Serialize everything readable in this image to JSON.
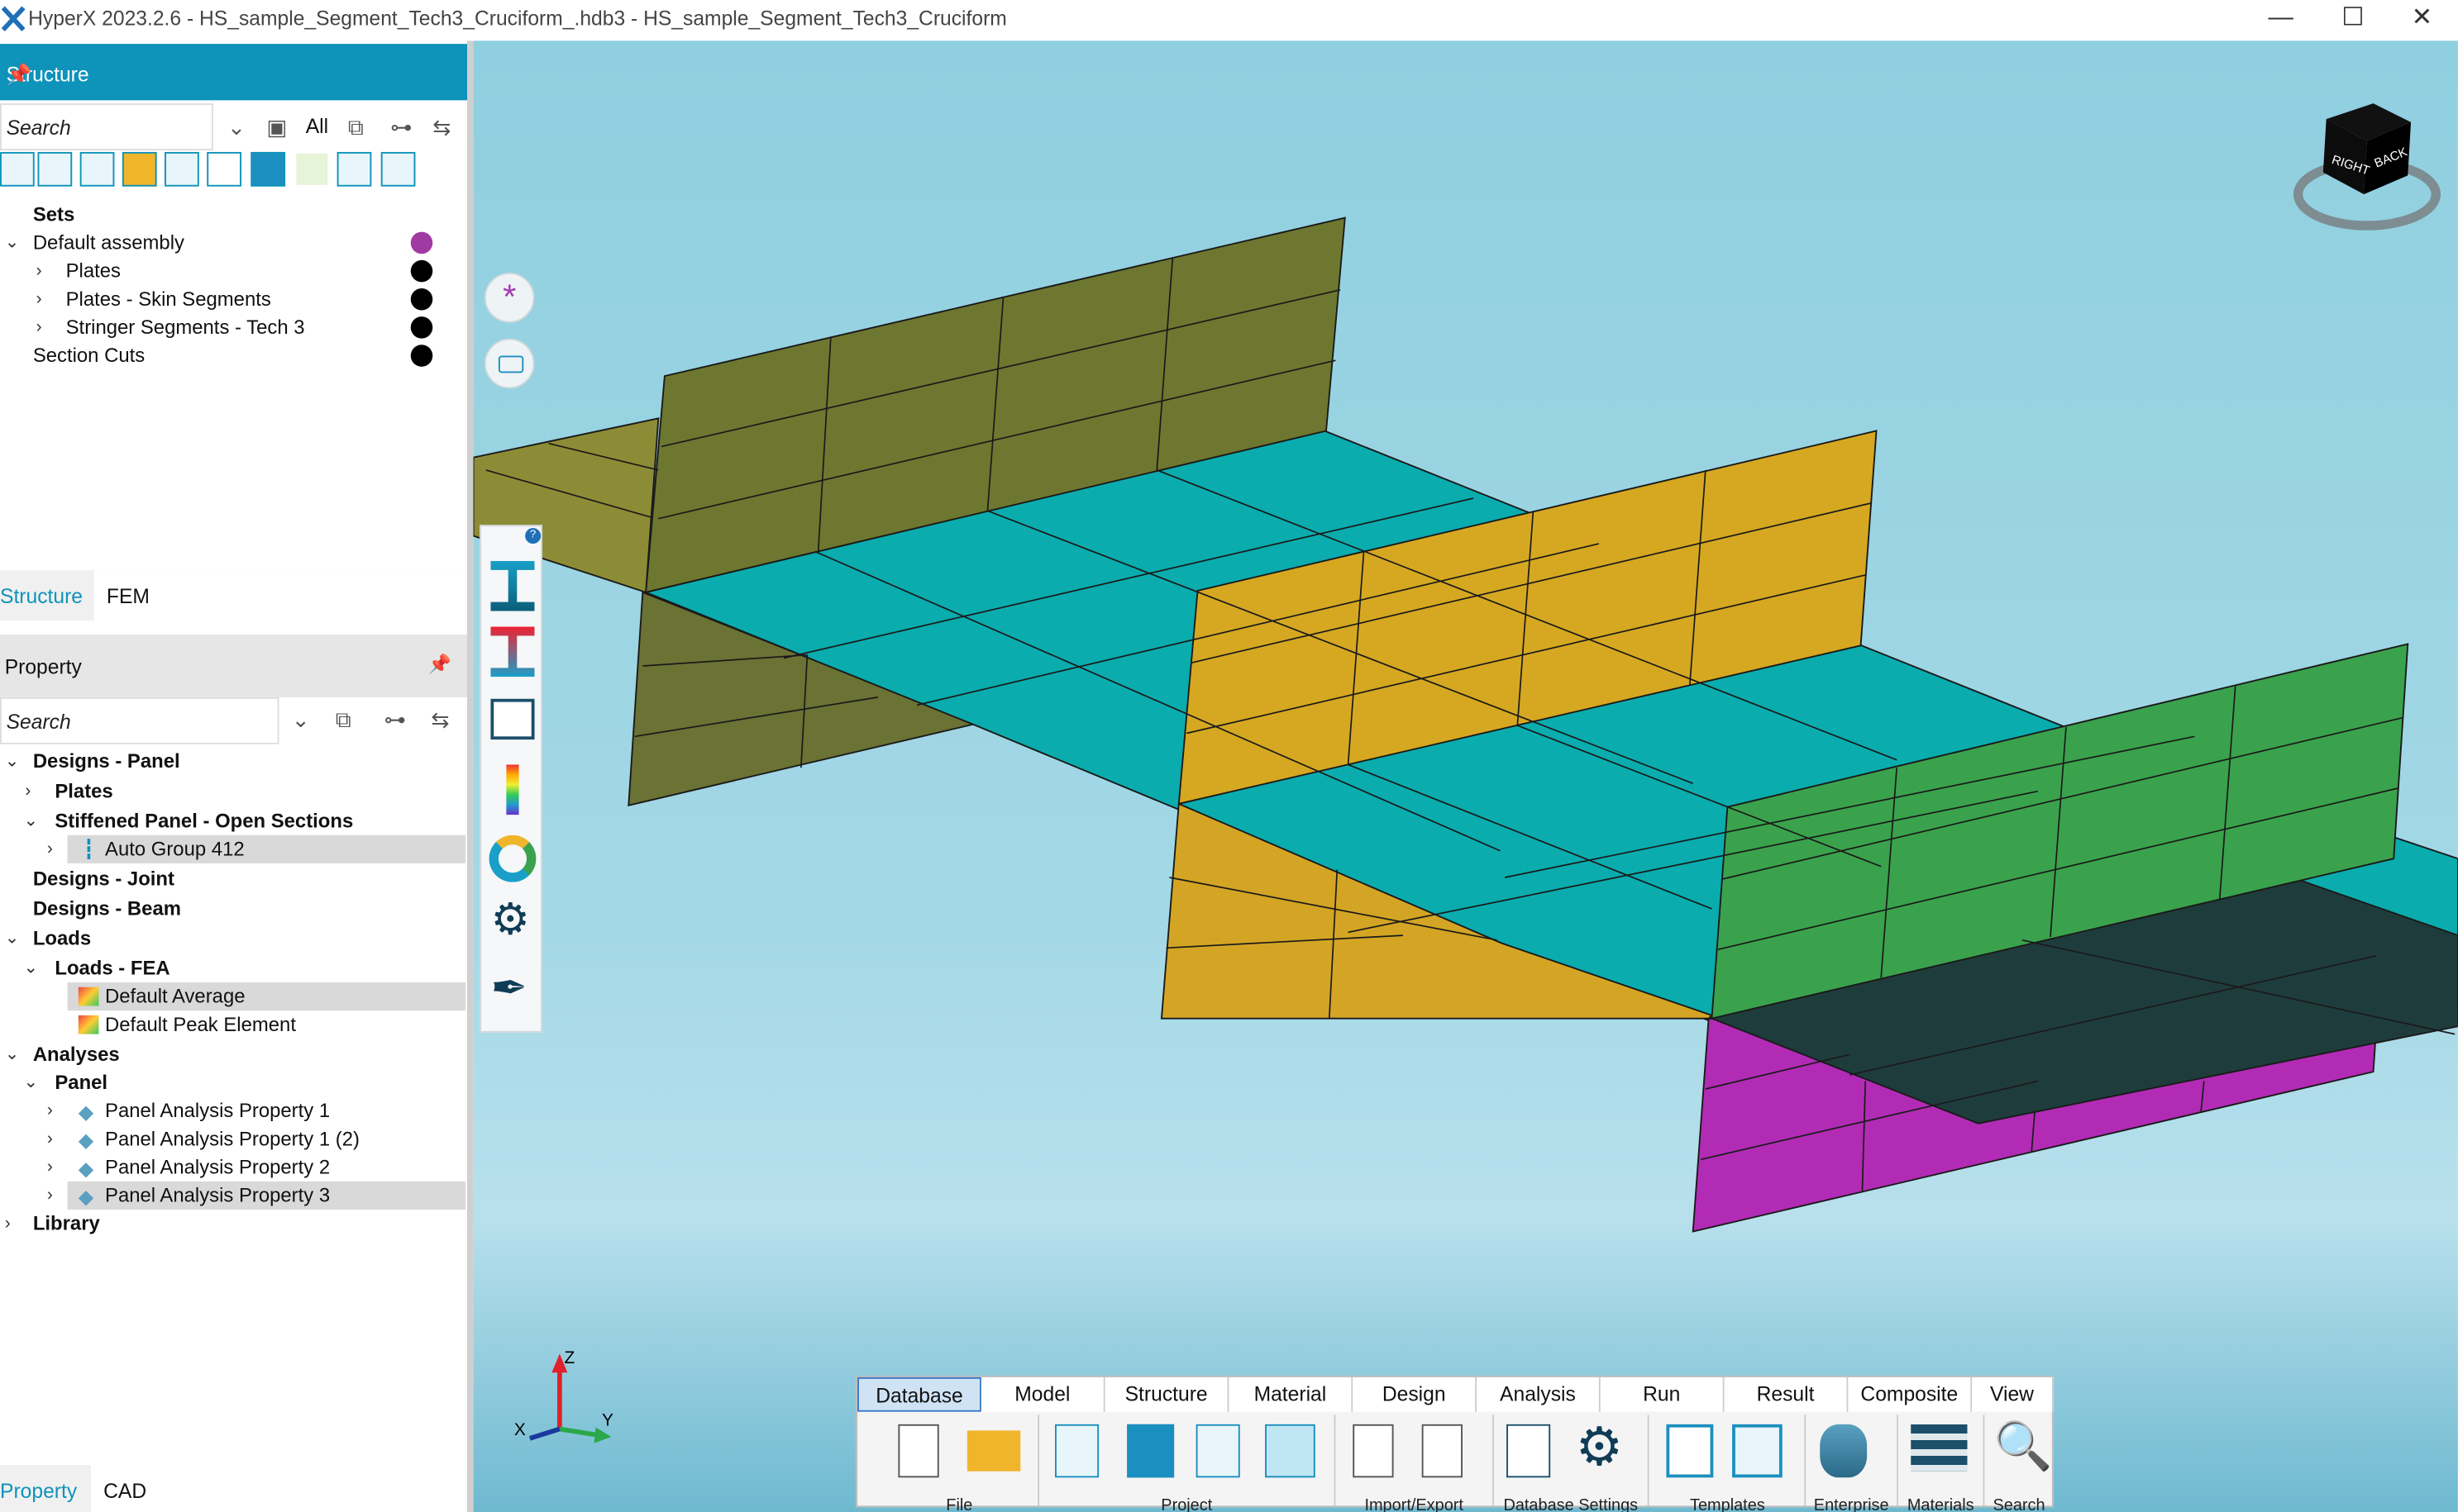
{
  "window": {
    "title": "HyperX 2023.2.6 - HS_sample_Segment_Tech3_Cruciform_.hdb3 - HS_sample_Segment_Tech3_Cruciform",
    "minimize": "—",
    "maximize": "☐",
    "close": "✕"
  },
  "structure_panel": {
    "header": "Structure",
    "search_placeholder": "Search",
    "all_label": "All",
    "tree": [
      {
        "label": "Sets"
      },
      {
        "label": "Default assembly",
        "color": "#a03aa3"
      },
      {
        "label": "Plates",
        "color": "#000000"
      },
      {
        "label": "Plates - Skin Segments",
        "color": "#000000"
      },
      {
        "label": "Stringer Segments - Tech 3",
        "color": "#000000"
      },
      {
        "label": "Section Cuts",
        "color": "#000000"
      }
    ],
    "tabs": [
      "Structure",
      "FEM"
    ]
  },
  "property_panel": {
    "header": "Property",
    "search_placeholder": "Search",
    "tree": [
      {
        "label": "Designs - Panel"
      },
      {
        "label": "Plates"
      },
      {
        "label": "Stiffened Panel - Open Sections"
      },
      {
        "label": "Auto Group 412"
      },
      {
        "label": "Designs - Joint"
      },
      {
        "label": "Designs - Beam"
      },
      {
        "label": "Loads"
      },
      {
        "label": "Loads - FEA"
      },
      {
        "label": "Default Average"
      },
      {
        "label": "Default Peak Element"
      },
      {
        "label": "Analyses"
      },
      {
        "label": "Panel"
      },
      {
        "label": "Panel Analysis Property 1"
      },
      {
        "label": "Panel Analysis Property 1 (2)"
      },
      {
        "label": "Panel Analysis Property 2"
      },
      {
        "label": "Panel Analysis Property 3"
      },
      {
        "label": "Library"
      }
    ],
    "tabs": [
      "Property",
      "CAD"
    ]
  },
  "viewcube": {
    "right": "RIGHT",
    "back": "BACK"
  },
  "triad": {
    "z": "Z",
    "y": "Y",
    "x": "X"
  },
  "ribbon": {
    "tabs": [
      "Database",
      "Model",
      "Structure",
      "Material",
      "Design",
      "Analysis",
      "Run",
      "Result",
      "Composite",
      "View"
    ],
    "groups": [
      "File",
      "Project",
      "Import/Export",
      "Database Settings",
      "Templates",
      "Enterprise",
      "Materials",
      "Search"
    ]
  },
  "colors": {
    "accent": "#0e93ba",
    "olive": "#6f7a2e",
    "cyan": "#0aacae",
    "yellow": "#d7a820",
    "green": "#3aa24c",
    "dark": "#1f3c3c",
    "magenta": "#b22bb5"
  }
}
